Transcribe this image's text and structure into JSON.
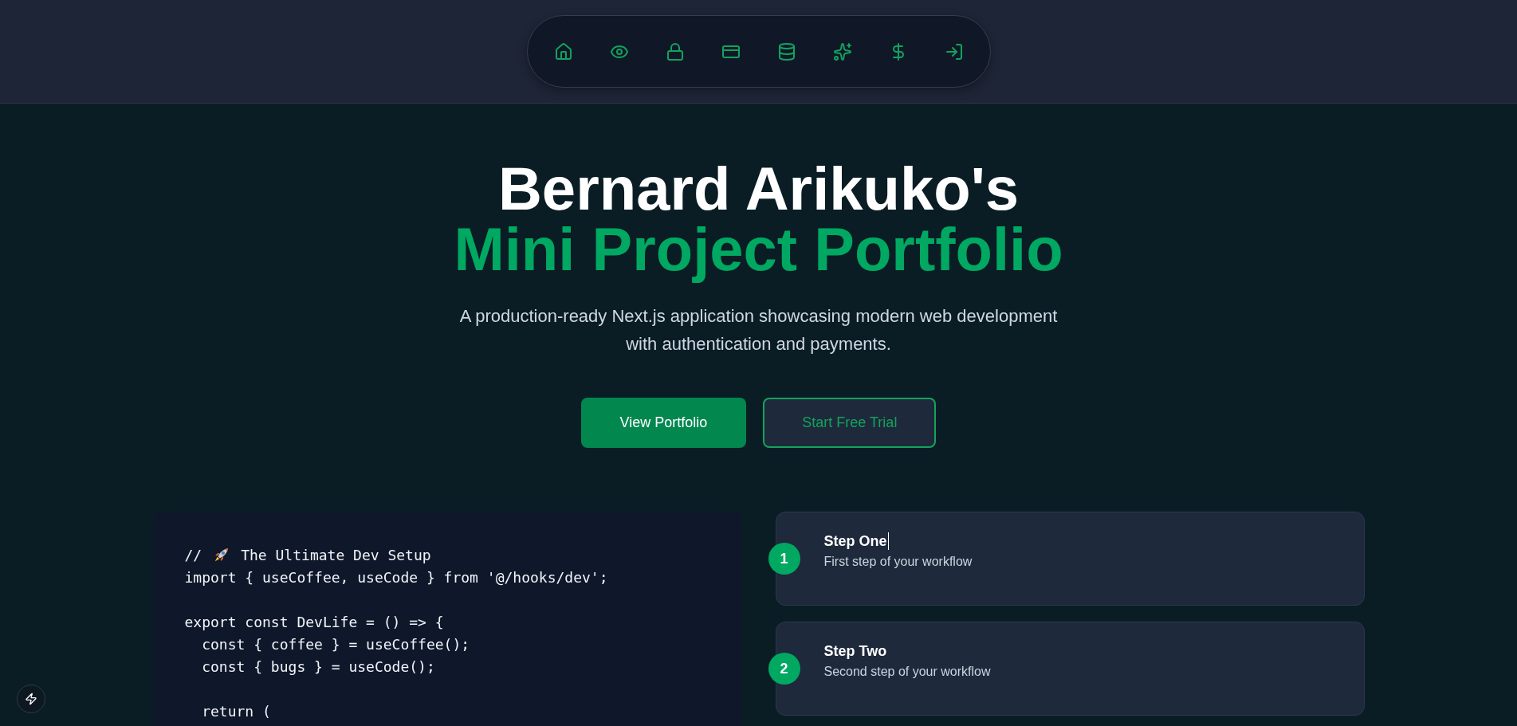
{
  "hero": {
    "title_line_1": "Bernard Arikuko's",
    "title_line_2": "Mini Project Portfolio",
    "subtitle": "A production-ready Next.js application showcasing modern web development with authentication and payments."
  },
  "buttons": [
    {
      "label": "View Portfolio",
      "kind": "primary"
    },
    {
      "label": "Start Free Trial",
      "kind": "outline"
    }
  ],
  "code": {
    "lines": [
      {
        "kind": "comment",
        "prefix": "//",
        "text": "The Ultimate Dev Setup"
      },
      {
        "kind": "line",
        "text": "import { useCoffee, useCode } from '@/hooks/dev';"
      },
      {
        "kind": "blank"
      },
      {
        "kind": "line",
        "text": "export const DevLife = () => {"
      },
      {
        "kind": "indented",
        "text": "const { coffee } = useCoffee();"
      },
      {
        "kind": "indented",
        "text": "const { bugs } = useCode();"
      },
      {
        "kind": "blank"
      },
      {
        "kind": "indented",
        "text": "return ("
      }
    ]
  },
  "steps": [
    {
      "number": "1",
      "title": "Step One",
      "description": "First step of your workflow",
      "cursor": true
    },
    {
      "number": "2",
      "title": "Step Two",
      "description": "Second step of your workflow",
      "cursor": false
    }
  ]
}
